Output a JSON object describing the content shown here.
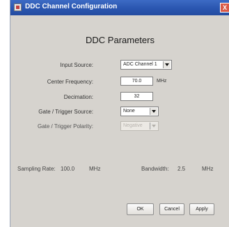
{
  "window": {
    "title": "DDC Channel Configuration",
    "close_symbol": "X"
  },
  "heading": "DDC Parameters",
  "fields": {
    "input_source": {
      "label": "Input Source:",
      "value": "ADC Channel 1"
    },
    "center_frequency": {
      "label": "Center Frequency:",
      "value": "70.0",
      "unit": "MHz"
    },
    "decimation": {
      "label": "Decimation:",
      "value": "32"
    },
    "gate_trigger_source": {
      "label": "Gate / Trigger Source:",
      "value": "None"
    },
    "gate_trigger_polarity": {
      "label": "Gate / Trigger Polarity:",
      "value": "Negative"
    }
  },
  "status": {
    "sampling_rate_label": "Sampling Rate:",
    "sampling_rate_value": "100.0",
    "sampling_rate_unit": "MHz",
    "bandwidth_label": "Bandwidth:",
    "bandwidth_value": "2.5",
    "bandwidth_unit": "MHz"
  },
  "buttons": {
    "ok": "OK",
    "cancel": "Cancel",
    "apply": "Apply"
  }
}
